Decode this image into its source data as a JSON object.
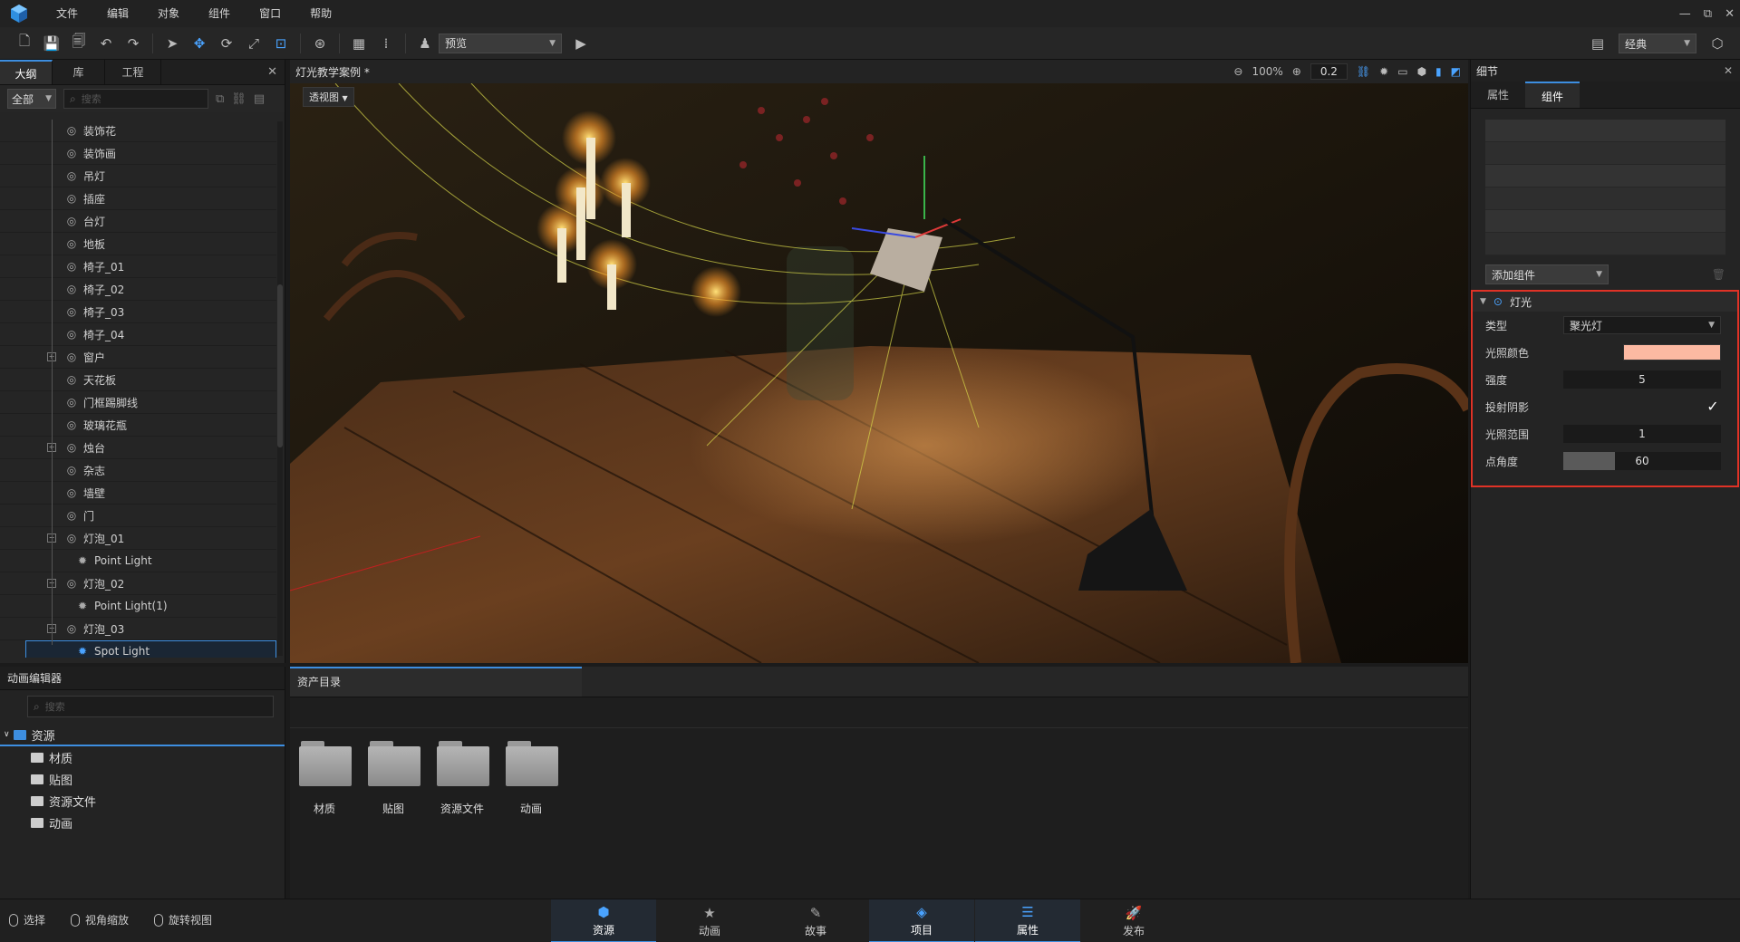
{
  "menubar": {
    "items": [
      "文件",
      "编辑",
      "对象",
      "组件",
      "窗口",
      "帮助"
    ],
    "window_controls": [
      "—",
      "⧉",
      "✕"
    ]
  },
  "toolbar": {
    "preview_label": "预览",
    "layout_label": "经典"
  },
  "outline": {
    "tabs": [
      "大纲",
      "库",
      "工程"
    ],
    "filter_value": "全部",
    "search_placeholder": "搜索",
    "items": [
      {
        "label": "装饰花"
      },
      {
        "label": "装饰画"
      },
      {
        "label": "吊灯"
      },
      {
        "label": "插座"
      },
      {
        "label": "台灯"
      },
      {
        "label": "地板"
      },
      {
        "label": "椅子_01"
      },
      {
        "label": "椅子_02"
      },
      {
        "label": "椅子_03"
      },
      {
        "label": "椅子_04"
      },
      {
        "label": "窗户"
      },
      {
        "label": "天花板"
      },
      {
        "label": "门框踢脚线"
      },
      {
        "label": "玻璃花瓶"
      },
      {
        "label": "烛台"
      },
      {
        "label": "杂志"
      },
      {
        "label": "墙壁"
      },
      {
        "label": "门"
      },
      {
        "label": "灯泡_01"
      },
      {
        "label": "Point Light"
      },
      {
        "label": "灯泡_02"
      },
      {
        "label": "Point Light(1)"
      },
      {
        "label": "灯泡_03"
      },
      {
        "label": "Spot Light"
      }
    ]
  },
  "viewport": {
    "title": "灯光教学案例 *",
    "zoom": "100%",
    "step": "0.2",
    "view_mode": "透视图"
  },
  "details": {
    "title": "细节",
    "tabs": [
      "属性",
      "组件"
    ],
    "add_component_label": "添加组件",
    "light_section_title": "灯光",
    "props": {
      "type_label": "类型",
      "type_value": "聚光灯",
      "color_label": "光照颜色",
      "color_value": "#fcb9a2",
      "intensity_label": "强度",
      "intensity_value": "5",
      "shadow_label": "投射阴影",
      "shadow_checked": true,
      "range_label": "光照范围",
      "range_value": "1",
      "angle_label": "点角度",
      "angle_value": "60",
      "angle_fraction": 0.33
    }
  },
  "animation_editor": {
    "title": "动画编辑器",
    "search_placeholder": "搜索",
    "root_label": "资源",
    "folders": [
      "材质",
      "贴图",
      "资源文件",
      "动画"
    ]
  },
  "assets": {
    "tab_label": "资产目录",
    "folders": [
      "材质",
      "贴图",
      "资源文件",
      "动画"
    ]
  },
  "status": {
    "select_label": "选择",
    "zoom_label": "视角缩放",
    "rotate_label": "旋转视图"
  },
  "bottom_tabs": [
    {
      "label": "资源",
      "icon": "resources-icon"
    },
    {
      "label": "动画",
      "icon": "animation-icon"
    },
    {
      "label": "故事",
      "icon": "story-icon"
    },
    {
      "label": "项目",
      "icon": "project-icon"
    },
    {
      "label": "属性",
      "icon": "properties-icon"
    },
    {
      "label": "发布",
      "icon": "publish-icon"
    }
  ],
  "colors": {
    "accent": "#3d8ee0",
    "highlight_border": "#e03226",
    "light_color": "#fcb9a2"
  }
}
